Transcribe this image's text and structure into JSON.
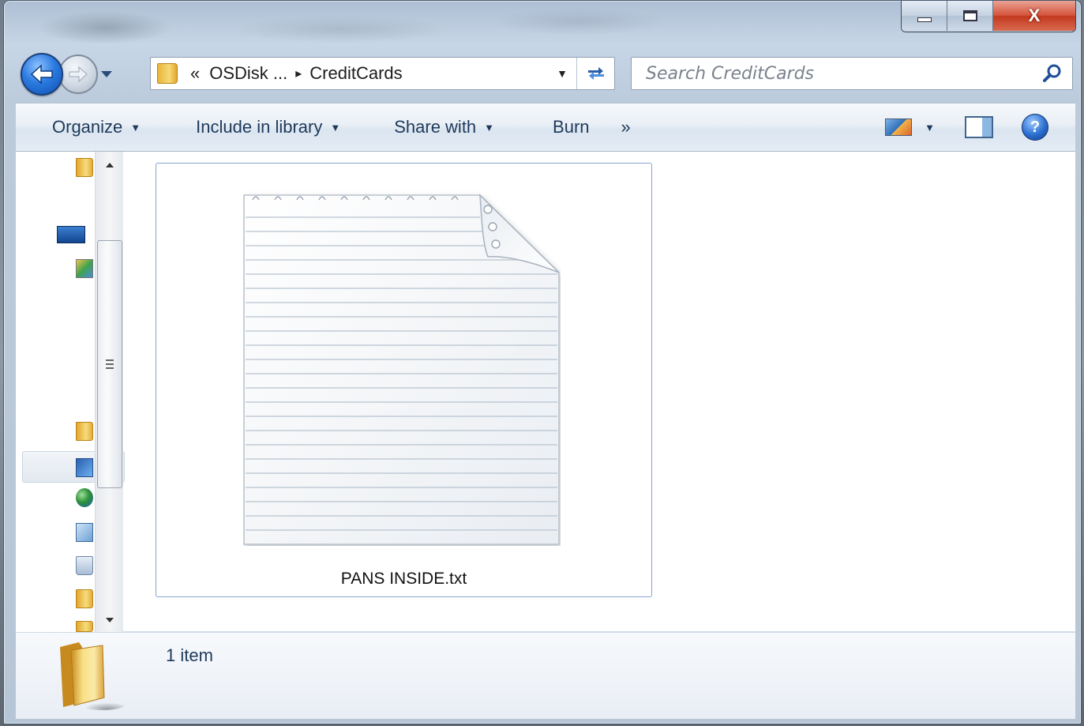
{
  "window": {
    "controls": {
      "minimize": "minimize",
      "maximize": "maximize",
      "close": "X"
    }
  },
  "navigation": {
    "back_icon": "back-arrow-icon",
    "forward_icon": "forward-arrow-icon"
  },
  "address": {
    "overflow": "«",
    "crumbs": [
      "OSDisk ...",
      "CreditCards"
    ],
    "separator": "▸",
    "dropdown": "▼",
    "refresh": "↻"
  },
  "search": {
    "placeholder": "Search CreditCards"
  },
  "toolbar": {
    "organize": "Organize",
    "include_in_library": "Include in library",
    "share_with": "Share with",
    "burn": "Burn",
    "more": "»",
    "dropdown_arrow": "▼",
    "help": "?"
  },
  "files": [
    {
      "name": "PANS INSIDE.txt",
      "icon": "text-document-icon"
    }
  ],
  "status": {
    "item_count": "1 item"
  },
  "colors": {
    "accent": "#1e395b",
    "selection_border": "#84a6cf",
    "close_button": "#c23a1f"
  }
}
